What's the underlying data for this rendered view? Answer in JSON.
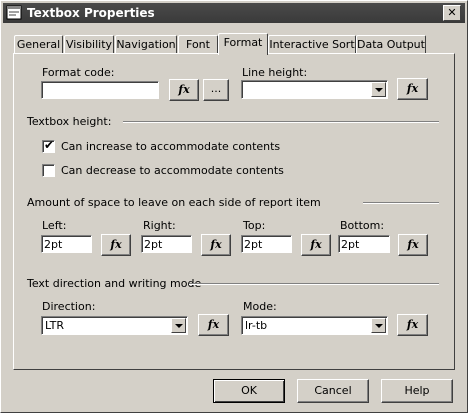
{
  "window": {
    "title": "Textbox Properties",
    "close_label": "✕"
  },
  "tabs": [
    {
      "label": "General"
    },
    {
      "label": "Visibility"
    },
    {
      "label": "Navigation"
    },
    {
      "label": "Font"
    },
    {
      "label": "Format"
    },
    {
      "label": "Interactive Sort"
    },
    {
      "label": "Data Output"
    }
  ],
  "format": {
    "format_code_label": "Format code:",
    "format_code_value": "",
    "ellipsis_label": "...",
    "line_height_label": "Line height:",
    "line_height_value": ""
  },
  "textbox_height": {
    "section_label": "Textbox height:",
    "can_increase_label": "Can increase to accommodate contents",
    "can_increase_checked": true,
    "can_decrease_label": "Can decrease to accommodate contents",
    "can_decrease_checked": false
  },
  "spacing": {
    "section_label": "Amount of space to leave on each side of report item",
    "left_label": "Left:",
    "left_value": "2pt",
    "right_label": "Right:",
    "right_value": "2pt",
    "top_label": "Top:",
    "top_value": "2pt",
    "bottom_label": "Bottom:",
    "bottom_value": "2pt"
  },
  "direction": {
    "section_label": "Text direction and writing mode",
    "direction_label": "Direction:",
    "direction_value": "LTR",
    "mode_label": "Mode:",
    "mode_value": "lr-tb"
  },
  "fx_label": "fx",
  "buttons": {
    "ok": "OK",
    "cancel": "Cancel",
    "help": "Help"
  },
  "checkmark": "✔"
}
